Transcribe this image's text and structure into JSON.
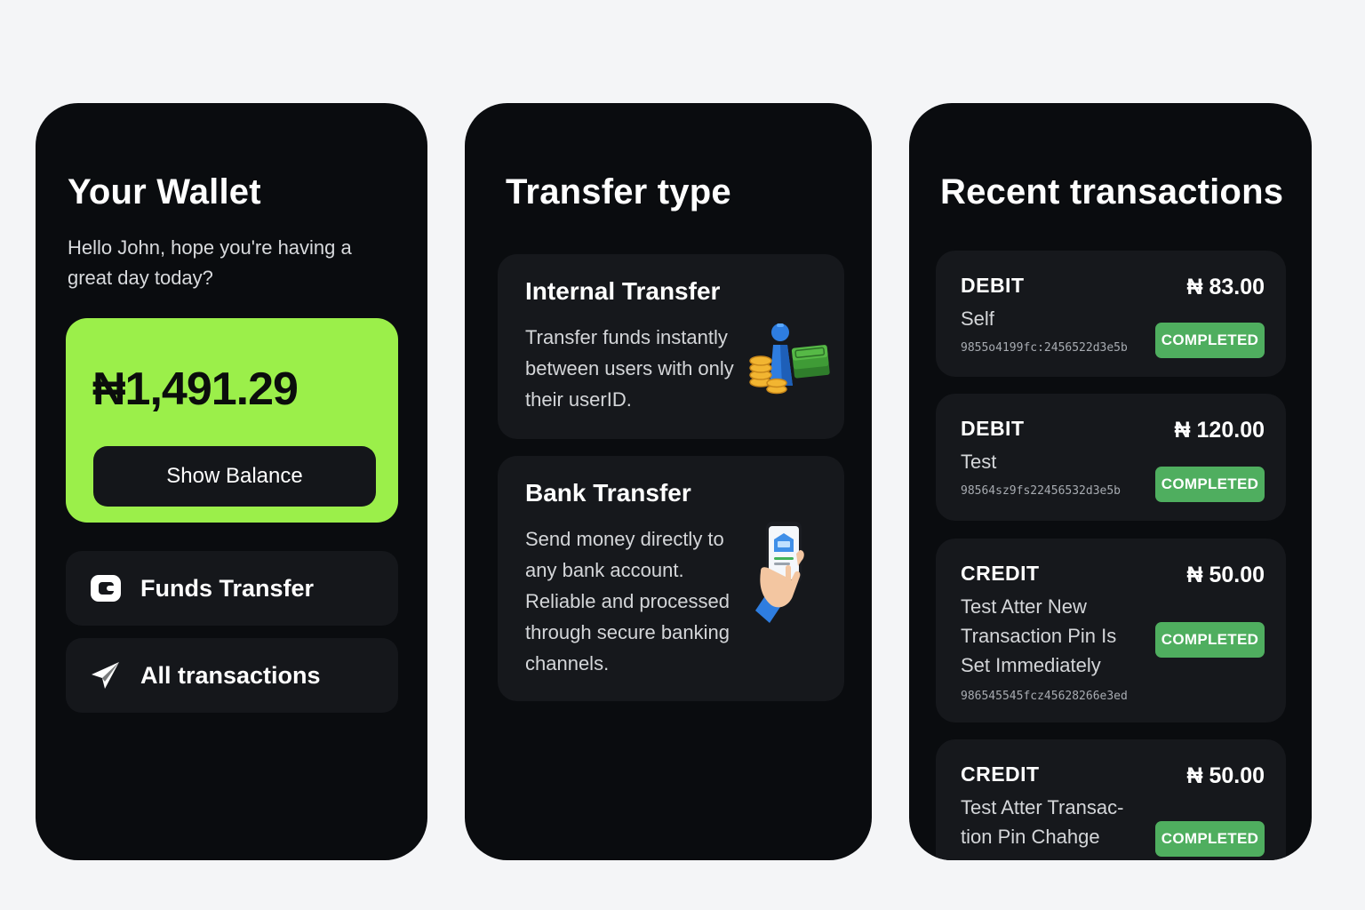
{
  "wallet": {
    "title": "Your Wallet",
    "greeting": "Hello John, hope you're having a great day today?",
    "balance": "₦1,491.29",
    "show_balance_label": "Show Balance",
    "menu": [
      {
        "label": "Funds Transfer",
        "icon": "wallet-icon"
      },
      {
        "label": "All transactions",
        "icon": "paper-plane-icon"
      }
    ],
    "accent_color": "#9bef4a"
  },
  "transfer": {
    "title": "Transfer type",
    "options": [
      {
        "title": "Internal Transfer",
        "description": "Transfer funds instantly between users with only their userID.",
        "icon": "coins-cash-icon"
      },
      {
        "title": "Bank Transfer",
        "description": "Send money directly to any bank account. Reliable and processed through secure banking channels.",
        "icon": "phone-hand-icon"
      }
    ]
  },
  "transactions": {
    "title": "Recent transactions",
    "status_color": "#4fae5f",
    "items": [
      {
        "type": "DEBIT",
        "amount": "₦ 83.00",
        "description": "Self",
        "id": "9855o4199fc:2456522d3e5b",
        "status": "COMPLETED"
      },
      {
        "type": "DEBIT",
        "amount": "₦ 120.00",
        "description": "Test",
        "id": "98564sz9fs22456532d3e5b",
        "status": "COMPLETED"
      },
      {
        "type": "CREDIT",
        "amount": "₦ 50.00",
        "description": "Test Atter New Transaction Pin Is Set Immediately",
        "id": "986545545fcz45628266e3ed",
        "status": "COMPLETED"
      },
      {
        "type": "CREDIT",
        "amount": "₦ 50.00",
        "description": "Test Atter Transac-tion Pin Chahge",
        "id": "",
        "status": "COMPLETED"
      }
    ]
  }
}
